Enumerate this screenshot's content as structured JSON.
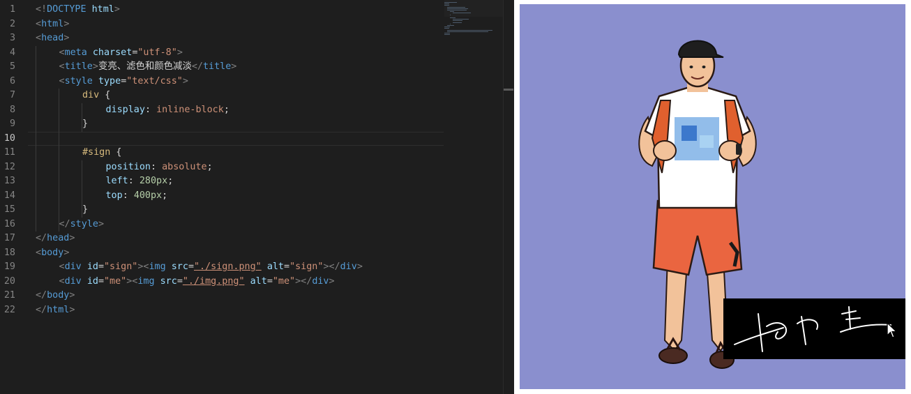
{
  "editor": {
    "lines": [
      {
        "n": "1",
        "indent": 0,
        "tokens": [
          [
            "t-punc",
            "<!"
          ],
          [
            "t-tag",
            "DOCTYPE "
          ],
          [
            "t-attr",
            "html"
          ],
          [
            "t-punc",
            ">"
          ]
        ]
      },
      {
        "n": "2",
        "indent": 0,
        "tokens": [
          [
            "t-punc",
            "<"
          ],
          [
            "t-tag",
            "html"
          ],
          [
            "t-punc",
            ">"
          ]
        ]
      },
      {
        "n": "3",
        "indent": 0,
        "tokens": [
          [
            "t-punc",
            "<"
          ],
          [
            "t-tag",
            "head"
          ],
          [
            "t-punc",
            ">"
          ]
        ]
      },
      {
        "n": "4",
        "indent": 1,
        "tokens": [
          [
            "t-punc",
            "<"
          ],
          [
            "t-tag",
            "meta "
          ],
          [
            "t-attr",
            "charset"
          ],
          [
            "t-text",
            "="
          ],
          [
            "t-str",
            "\"utf-8\""
          ],
          [
            "t-punc",
            ">"
          ]
        ]
      },
      {
        "n": "5",
        "indent": 1,
        "tokens": [
          [
            "t-punc",
            "<"
          ],
          [
            "t-tag",
            "title"
          ],
          [
            "t-punc",
            ">"
          ],
          [
            "t-text",
            "变亮、滤色和颜色减淡"
          ],
          [
            "t-punc",
            "</"
          ],
          [
            "t-tag",
            "title"
          ],
          [
            "t-punc",
            ">"
          ]
        ]
      },
      {
        "n": "6",
        "indent": 1,
        "tokens": [
          [
            "t-punc",
            "<"
          ],
          [
            "t-tag",
            "style "
          ],
          [
            "t-attr",
            "type"
          ],
          [
            "t-text",
            "="
          ],
          [
            "t-str",
            "\"text/css\""
          ],
          [
            "t-punc",
            ">"
          ]
        ]
      },
      {
        "n": "7",
        "indent": 2,
        "tokens": [
          [
            "t-sel",
            "div"
          ],
          [
            "t-text",
            " {"
          ]
        ]
      },
      {
        "n": "8",
        "indent": 3,
        "tokens": [
          [
            "t-prop",
            "display"
          ],
          [
            "t-text",
            ": "
          ],
          [
            "t-str",
            "inline-block"
          ],
          [
            "t-text",
            ";"
          ]
        ]
      },
      {
        "n": "9",
        "indent": 2,
        "tokens": [
          [
            "t-text",
            "}"
          ]
        ]
      },
      {
        "n": "10",
        "indent": 0,
        "tokens": [],
        "current": true
      },
      {
        "n": "11",
        "indent": 2,
        "tokens": [
          [
            "t-sel",
            "#sign"
          ],
          [
            "t-text",
            " {"
          ]
        ]
      },
      {
        "n": "12",
        "indent": 3,
        "tokens": [
          [
            "t-prop",
            "position"
          ],
          [
            "t-text",
            ": "
          ],
          [
            "t-str",
            "absolute"
          ],
          [
            "t-text",
            ";"
          ]
        ]
      },
      {
        "n": "13",
        "indent": 3,
        "tokens": [
          [
            "t-prop",
            "left"
          ],
          [
            "t-text",
            ": "
          ],
          [
            "t-num",
            "280px"
          ],
          [
            "t-text",
            ";"
          ]
        ]
      },
      {
        "n": "14",
        "indent": 3,
        "tokens": [
          [
            "t-prop",
            "top"
          ],
          [
            "t-text",
            ": "
          ],
          [
            "t-num",
            "400px"
          ],
          [
            "t-text",
            ";"
          ]
        ]
      },
      {
        "n": "15",
        "indent": 2,
        "tokens": [
          [
            "t-text",
            "}"
          ]
        ]
      },
      {
        "n": "16",
        "indent": 1,
        "tokens": [
          [
            "t-punc",
            "</"
          ],
          [
            "t-tag",
            "style"
          ],
          [
            "t-punc",
            ">"
          ]
        ]
      },
      {
        "n": "17",
        "indent": 0,
        "tokens": [
          [
            "t-punc",
            "</"
          ],
          [
            "t-tag",
            "head"
          ],
          [
            "t-punc",
            ">"
          ]
        ]
      },
      {
        "n": "18",
        "indent": 0,
        "tokens": [
          [
            "t-punc",
            "<"
          ],
          [
            "t-tag",
            "body"
          ],
          [
            "t-punc",
            ">"
          ]
        ]
      },
      {
        "n": "19",
        "indent": 1,
        "tokens": [
          [
            "t-punc",
            "<"
          ],
          [
            "t-tag",
            "div "
          ],
          [
            "t-attr",
            "id"
          ],
          [
            "t-text",
            "="
          ],
          [
            "t-str",
            "\"sign\""
          ],
          [
            "t-punc",
            "><"
          ],
          [
            "t-tag",
            "img "
          ],
          [
            "t-attr",
            "src"
          ],
          [
            "t-text",
            "="
          ],
          [
            "t-str t-link",
            "\"./sign.png\""
          ],
          [
            "t-text",
            " "
          ],
          [
            "t-attr",
            "alt"
          ],
          [
            "t-text",
            "="
          ],
          [
            "t-str",
            "\"sign\""
          ],
          [
            "t-punc",
            "></"
          ],
          [
            "t-tag",
            "div"
          ],
          [
            "t-punc",
            ">"
          ]
        ]
      },
      {
        "n": "20",
        "indent": 1,
        "tokens": [
          [
            "t-punc",
            "<"
          ],
          [
            "t-tag",
            "div "
          ],
          [
            "t-attr",
            "id"
          ],
          [
            "t-text",
            "="
          ],
          [
            "t-str",
            "\"me\""
          ],
          [
            "t-punc",
            "><"
          ],
          [
            "t-tag",
            "img "
          ],
          [
            "t-attr",
            "src"
          ],
          [
            "t-text",
            "="
          ],
          [
            "t-str t-link",
            "\"./img.png\""
          ],
          [
            "t-text",
            " "
          ],
          [
            "t-attr",
            "alt"
          ],
          [
            "t-text",
            "="
          ],
          [
            "t-str",
            "\"me\""
          ],
          [
            "t-punc",
            "></"
          ],
          [
            "t-tag",
            "div"
          ],
          [
            "t-punc",
            ">"
          ]
        ]
      },
      {
        "n": "21",
        "indent": 0,
        "tokens": [
          [
            "t-punc",
            "</"
          ],
          [
            "t-tag",
            "body"
          ],
          [
            "t-punc",
            ">"
          ]
        ]
      },
      {
        "n": "22",
        "indent": 0,
        "tokens": [
          [
            "t-punc",
            "</"
          ],
          [
            "t-tag",
            "html"
          ],
          [
            "t-punc",
            ">"
          ]
        ]
      }
    ]
  },
  "preview": {
    "stage_color": "#8a8fce",
    "images": [
      {
        "name": "person-illustration",
        "alt": "me"
      },
      {
        "name": "signature-image",
        "alt": "sign"
      }
    ]
  },
  "icons": [
    "mouse-cursor-icon"
  ]
}
